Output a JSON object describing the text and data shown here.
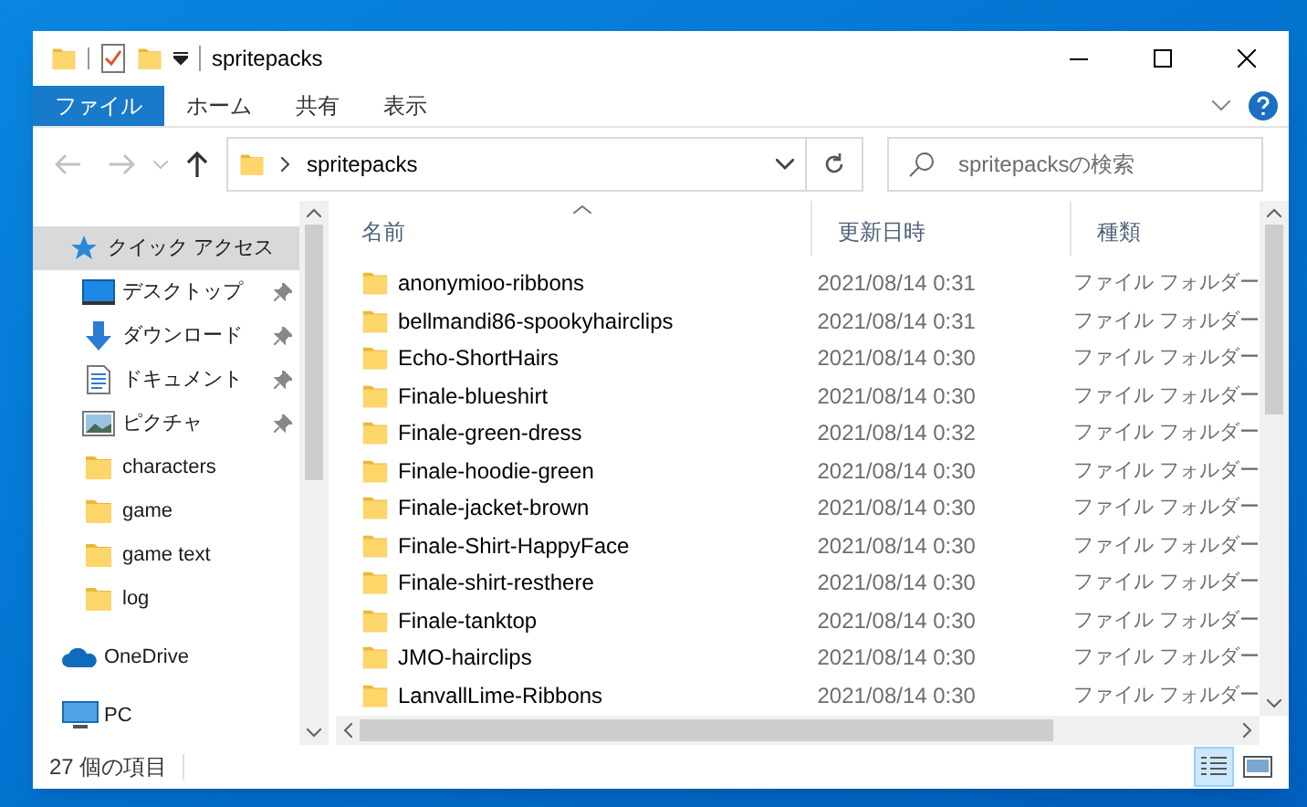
{
  "window": {
    "title": "spritepacks"
  },
  "ribbon_tabs": [
    {
      "label": "ファイル",
      "selected": true
    },
    {
      "label": "ホーム",
      "selected": false
    },
    {
      "label": "共有",
      "selected": false
    },
    {
      "label": "表示",
      "selected": false
    }
  ],
  "address": {
    "path": "spritepacks"
  },
  "search": {
    "placeholder": "spritepacksの検索"
  },
  "sidebar": {
    "items": [
      {
        "label": "クイック アクセス",
        "kind": "star",
        "selected": true,
        "children": [
          {
            "label": "デスクトップ",
            "kind": "desktop",
            "pinned": true
          },
          {
            "label": "ダウンロード",
            "kind": "download",
            "pinned": true
          },
          {
            "label": "ドキュメント",
            "kind": "document",
            "pinned": true
          },
          {
            "label": "ピクチャ",
            "kind": "picture",
            "pinned": true
          },
          {
            "label": "characters",
            "kind": "folder",
            "pinned": false
          },
          {
            "label": "game",
            "kind": "folder",
            "pinned": false
          },
          {
            "label": "game text",
            "kind": "folder",
            "pinned": false
          },
          {
            "label": "log",
            "kind": "folder",
            "pinned": false
          }
        ]
      },
      {
        "label": "OneDrive",
        "kind": "cloud",
        "selected": false
      },
      {
        "label": "PC",
        "kind": "pc",
        "selected": false
      }
    ]
  },
  "table": {
    "columns": [
      {
        "label": "名前",
        "sorted": true
      },
      {
        "label": "更新日時",
        "sorted": false
      },
      {
        "label": "種類",
        "sorted": false
      }
    ],
    "rows": [
      {
        "name": "anonymioo-ribbons",
        "date": "2021/08/14 0:31",
        "type": "ファイル フォルダー"
      },
      {
        "name": "bellmandi86-spookyhairclips",
        "date": "2021/08/14 0:31",
        "type": "ファイル フォルダー"
      },
      {
        "name": "Echo-ShortHairs",
        "date": "2021/08/14 0:30",
        "type": "ファイル フォルダー"
      },
      {
        "name": "Finale-blueshirt",
        "date": "2021/08/14 0:30",
        "type": "ファイル フォルダー"
      },
      {
        "name": "Finale-green-dress",
        "date": "2021/08/14 0:32",
        "type": "ファイル フォルダー"
      },
      {
        "name": "Finale-hoodie-green",
        "date": "2021/08/14 0:30",
        "type": "ファイル フォルダー"
      },
      {
        "name": "Finale-jacket-brown",
        "date": "2021/08/14 0:30",
        "type": "ファイル フォルダー"
      },
      {
        "name": "Finale-Shirt-HappyFace",
        "date": "2021/08/14 0:30",
        "type": "ファイル フォルダー"
      },
      {
        "name": "Finale-shirt-resthere",
        "date": "2021/08/14 0:30",
        "type": "ファイル フォルダー"
      },
      {
        "name": "Finale-tanktop",
        "date": "2021/08/14 0:30",
        "type": "ファイル フォルダー"
      },
      {
        "name": "JMO-hairclips",
        "date": "2021/08/14 0:30",
        "type": "ファイル フォルダー"
      },
      {
        "name": "LanvallLime-Ribbons",
        "date": "2021/08/14 0:30",
        "type": "ファイル フォルダー"
      }
    ]
  },
  "status_bar": {
    "text": "27 個の項目",
    "views": [
      {
        "kind": "details",
        "selected": true
      },
      {
        "kind": "thumbnails",
        "selected": false
      }
    ]
  }
}
